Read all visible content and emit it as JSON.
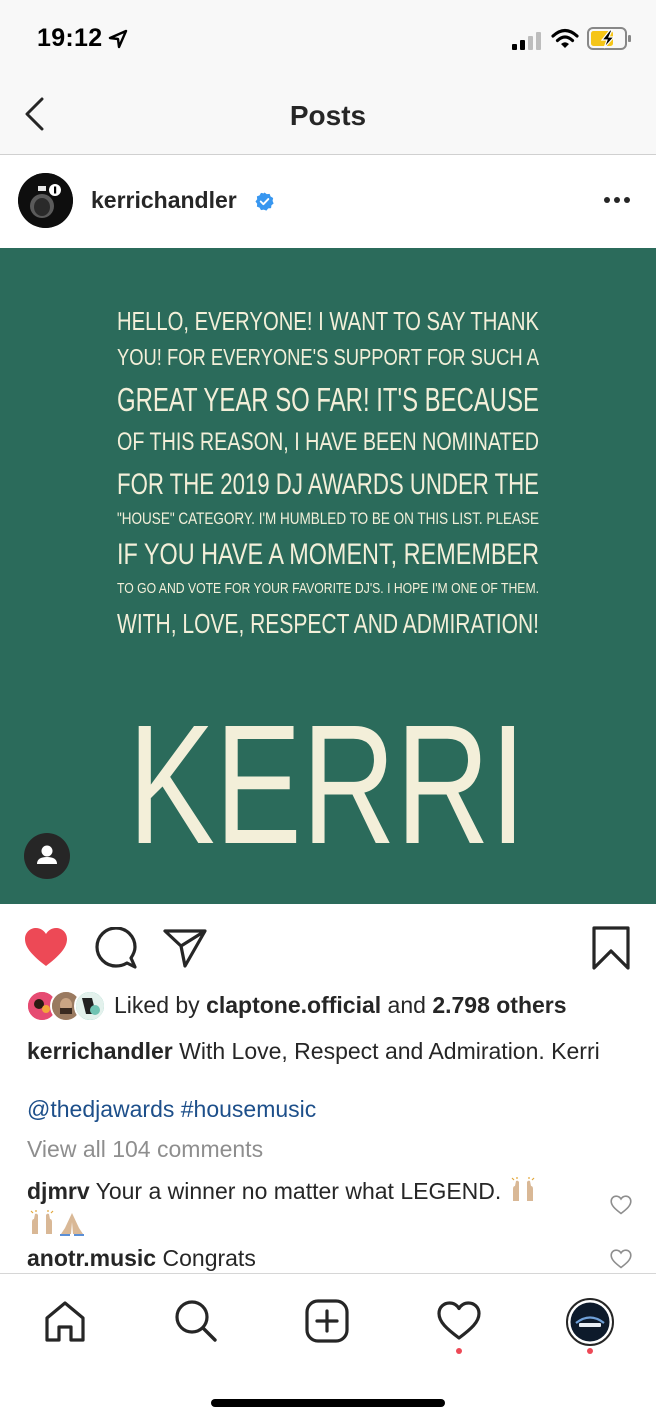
{
  "status_bar": {
    "time": "19:12"
  },
  "nav": {
    "title": "Posts"
  },
  "post": {
    "username": "kerrichandler",
    "image_lines": [
      "HELLO, EVERYONE! I WANT TO SAY THANK",
      "YOU! FOR EVERYONE'S SUPPORT FOR SUCH A",
      "GREAT YEAR SO FAR! IT'S BECAUSE",
      "OF THIS REASON, I HAVE BEEN NOMINATED",
      "FOR THE 2019 DJ AWARDS UNDER THE",
      "\"HOUSE\" CATEGORY. I'M HUMBLED TO BE ON THIS LIST. PLEASE",
      "IF YOU HAVE A MOMENT, REMEMBER",
      "TO GO AND VOTE FOR YOUR FAVORITE DJ'S. I HOPE I'M ONE OF THEM.",
      "WITH, LOVE, RESPECT AND ADMIRATION!"
    ],
    "image_signature": "KERRI",
    "likes": {
      "prefix": "Liked by ",
      "user": "claptone.official",
      "middle": " and ",
      "count": "2.798 others"
    },
    "caption_user": "kerrichandler",
    "caption_text": " With Love, Respect and Admiration. Kerri",
    "hashtags": "@thedjawards #housemusic",
    "view_all": "View all 104 comments",
    "comments": [
      {
        "user": "djmrv",
        "text": " Your a winner no matter what LEGEND. "
      },
      {
        "user": "anotr.music",
        "text": " Congrats"
      }
    ]
  },
  "colors": {
    "post_bg": "#2b6b5b",
    "post_text": "#f3efd9",
    "like_red": "#ed4956",
    "link_blue": "#1d4f8a",
    "verified_blue": "#3897f0"
  },
  "icons": {
    "back": "chevron-left-icon",
    "more": "more-horizontal-icon",
    "like": "heart-filled-icon",
    "comment": "comment-bubble-icon",
    "share": "send-paper-plane-icon",
    "save": "bookmark-icon",
    "tag": "person-tag-icon",
    "tabs": [
      "home-icon",
      "search-icon",
      "add-post-icon",
      "activity-heart-icon",
      "profile-avatar-icon"
    ]
  }
}
